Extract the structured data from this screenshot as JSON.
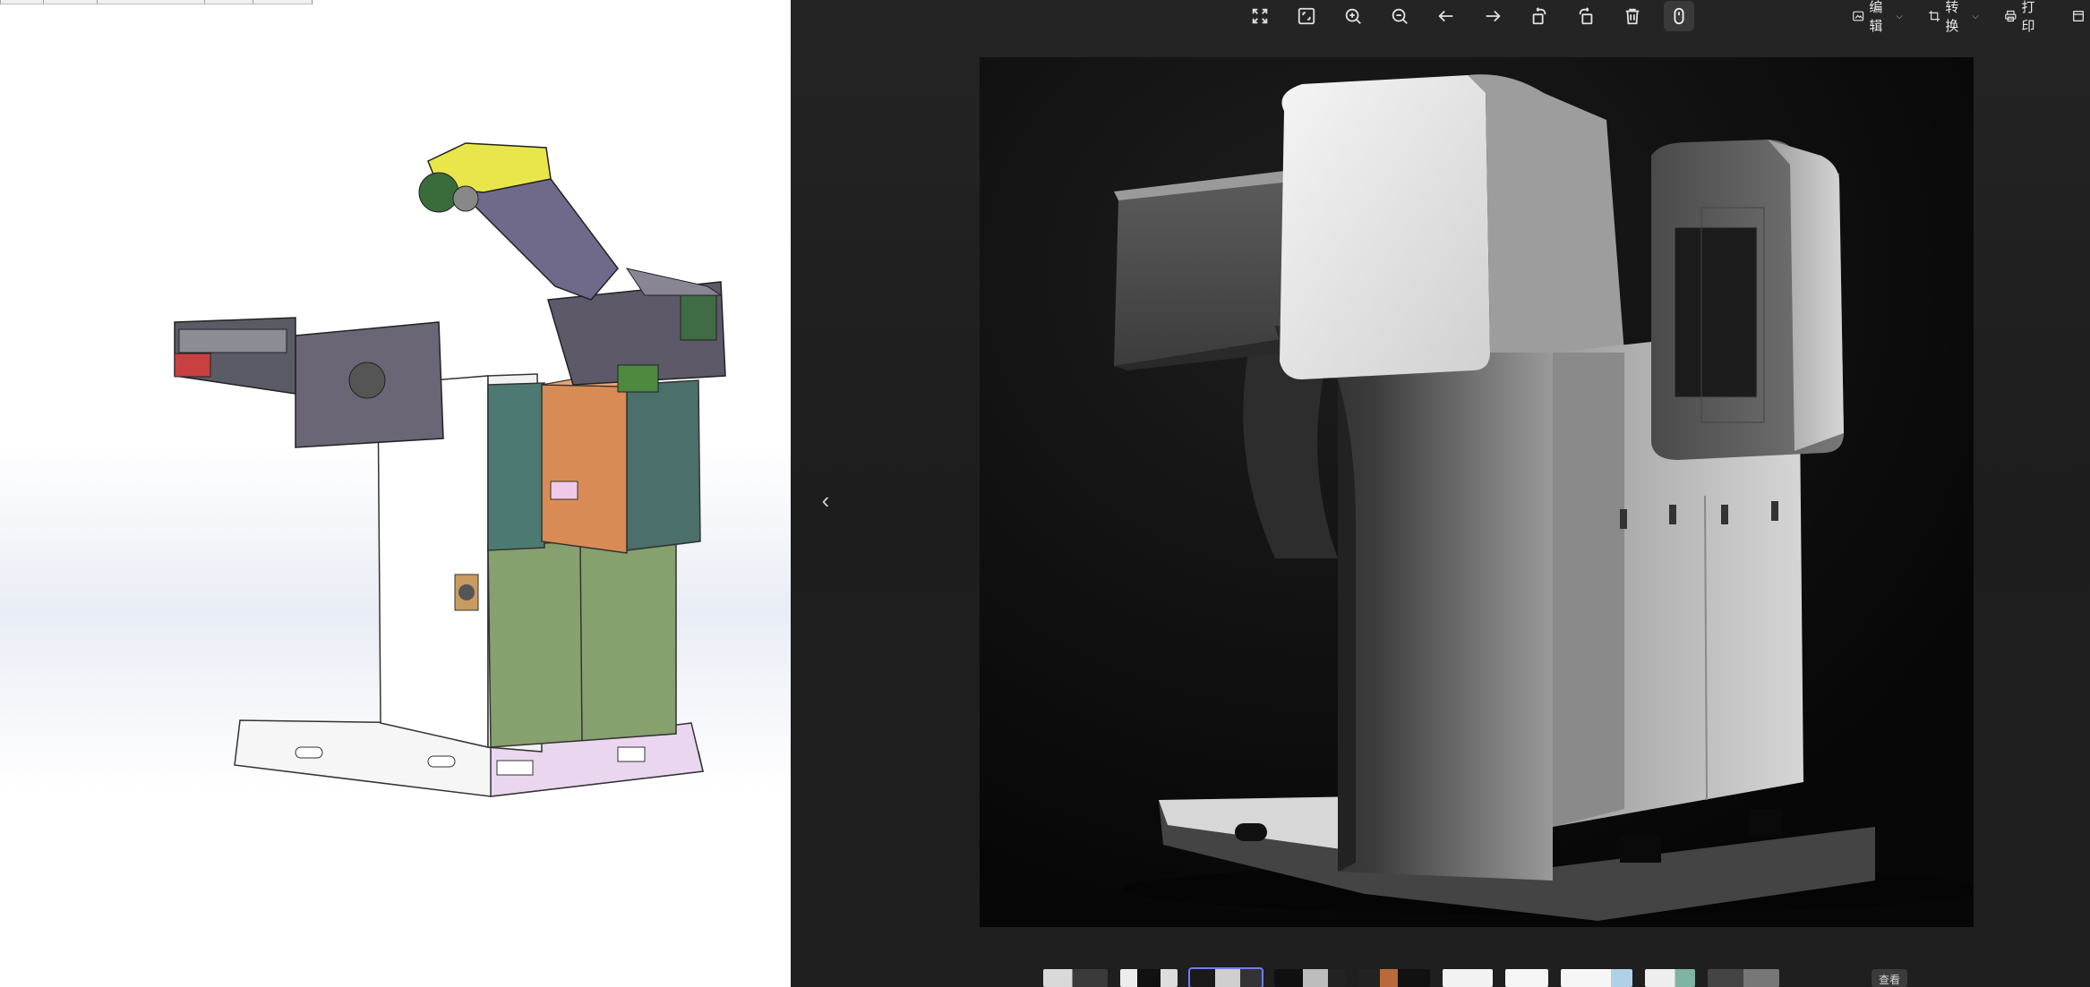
{
  "toolbar": {
    "buttons": [
      {
        "icon": "fullscreen-icon"
      },
      {
        "icon": "fit-to-window-icon"
      },
      {
        "icon": "zoom-in-icon"
      },
      {
        "icon": "zoom-out-icon"
      },
      {
        "icon": "arrow-left-icon"
      },
      {
        "icon": "arrow-right-icon"
      },
      {
        "icon": "rotate-left-icon"
      },
      {
        "icon": "rotate-right-icon"
      },
      {
        "icon": "trash-icon"
      },
      {
        "icon": "mouse-icon"
      }
    ]
  },
  "menu": {
    "edit": "编辑",
    "convert": "转换",
    "print": "打印"
  },
  "filmstrip": {
    "view_all": "查看",
    "selected_index": 2
  },
  "colors": {
    "viewer_bg": "#1f1f1f",
    "selection": "#6d7cff"
  }
}
